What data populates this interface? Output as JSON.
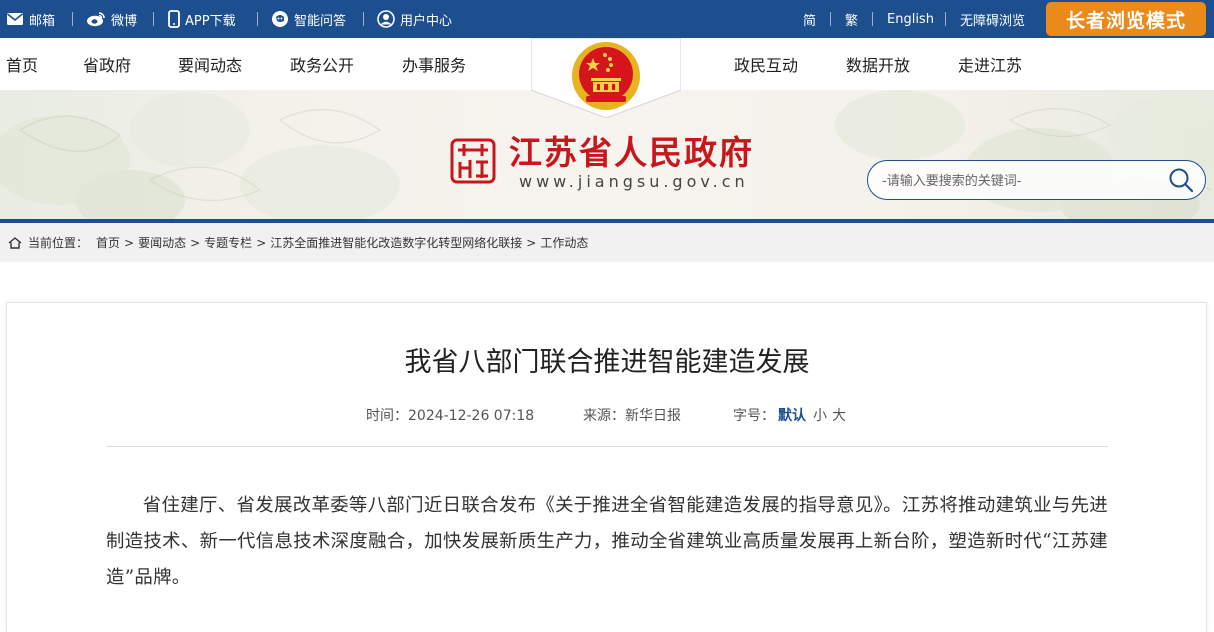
{
  "topbar": {
    "left_links": [
      {
        "label": "邮箱",
        "icon": "mail-icon"
      },
      {
        "label": "微博",
        "icon": "weibo-icon"
      },
      {
        "label": "APP下载",
        "icon": "phone-icon"
      },
      {
        "label": "智能问答",
        "icon": "chat-icon"
      },
      {
        "label": "用户中心",
        "icon": "user-icon"
      }
    ],
    "right_links": [
      "简",
      "繁",
      "English",
      "无障碍浏览"
    ],
    "elder_mode": "长者浏览模式"
  },
  "nav": {
    "left": [
      "首页",
      "省政府",
      "要闻动态",
      "政务公开",
      "办事服务"
    ],
    "right": [
      "政民互动",
      "数据开放",
      "走进江苏"
    ]
  },
  "header": {
    "title": "江苏省人民政府",
    "url": "www.jiangsu.gov.cn",
    "search_placeholder": "-请输入要搜索的关键词-"
  },
  "breadcrumb": {
    "prefix": "当前位置：",
    "items": [
      "首页",
      "要闻动态",
      "专题专栏",
      "江苏全面推进智能化改造数字化转型网络化联接",
      "工作动态"
    ]
  },
  "article": {
    "title": "我省八部门联合推进智能建造发展",
    "time_label": "时间：",
    "time": "2024-12-26 07:18",
    "source_label": "来源：",
    "source": "新华日报",
    "fontsize_label": "字号：",
    "fontsize_options": [
      "默认",
      "小",
      "大"
    ],
    "body": "省住建厅、省发展改革委等八部门近日联合发布《关于推进全省智能建造发展的指导意见》。江苏将推动建筑业与先进制造技术、新一代信息技术深度融合，加快发展新质生产力，推动全省建筑业高质量发展再上新台阶，塑造新时代“江苏建造”品牌。"
  },
  "colors": {
    "primary_blue": "#1d4f8e",
    "elder_orange": "#e98a1a",
    "title_red": "#c8161d"
  }
}
